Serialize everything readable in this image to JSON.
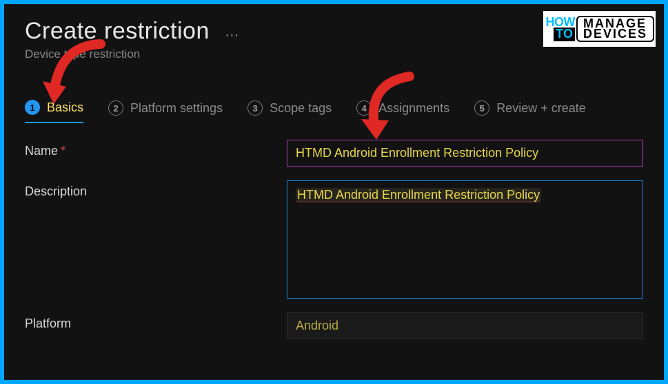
{
  "header": {
    "title": "Create restriction",
    "subtitle": "Device type restriction"
  },
  "tabs": [
    {
      "num": "1",
      "label": "Basics",
      "active": true
    },
    {
      "num": "2",
      "label": "Platform settings",
      "active": false
    },
    {
      "num": "3",
      "label": "Scope tags",
      "active": false
    },
    {
      "num": "4",
      "label": "Assignments",
      "active": false
    },
    {
      "num": "5",
      "label": "Review + create",
      "active": false
    }
  ],
  "form": {
    "name_label": "Name",
    "name_value": "HTMD Android Enrollment Restriction Policy",
    "description_label": "Description",
    "description_value": "HTMD Android Enrollment Restriction Policy",
    "platform_label": "Platform",
    "platform_value": "Android"
  },
  "logo": {
    "how": "HOW",
    "to": "TO",
    "manage": "MANAGE",
    "devices": "DEVICES"
  }
}
